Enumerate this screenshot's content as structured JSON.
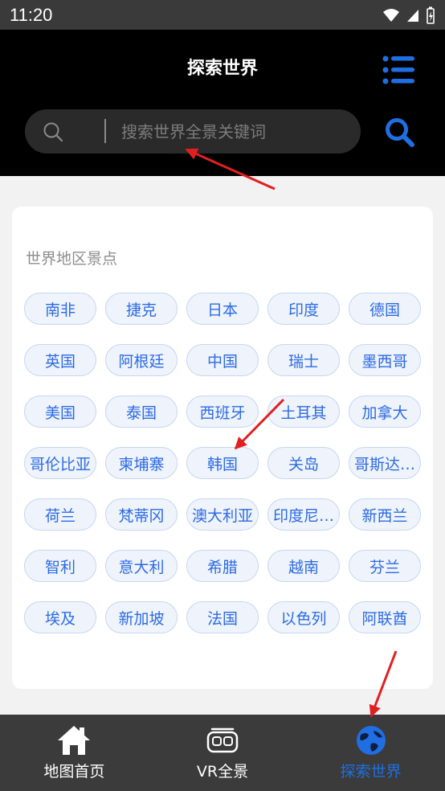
{
  "status": {
    "time": "11:20"
  },
  "header": {
    "title": "探索世界",
    "search_placeholder": "搜索世界全景关键词"
  },
  "section": {
    "title": "世界地区景点",
    "items": [
      "南非",
      "捷克",
      "日本",
      "印度",
      "德国",
      "英国",
      "阿根廷",
      "中国",
      "瑞士",
      "墨西哥",
      "美国",
      "泰国",
      "西班牙",
      "土耳其",
      "加拿大",
      "哥伦比亚",
      "柬埔寨",
      "韩国",
      "关岛",
      "哥斯达…",
      "荷兰",
      "梵蒂冈",
      "澳大利亚",
      "印度尼…",
      "新西兰",
      "智利",
      "意大利",
      "希腊",
      "越南",
      "芬兰",
      "埃及",
      "新加坡",
      "法国",
      "以色列",
      "阿联酋"
    ]
  },
  "tabbar": {
    "tabs": [
      {
        "label": "地图首页"
      },
      {
        "label": "VR全景"
      },
      {
        "label": "探索世界"
      }
    ]
  },
  "colors": {
    "accent": "#1f6fe3",
    "chip_text": "#2d6be4",
    "chip_bg": "#eef3fc",
    "annotation": "#e02020"
  }
}
